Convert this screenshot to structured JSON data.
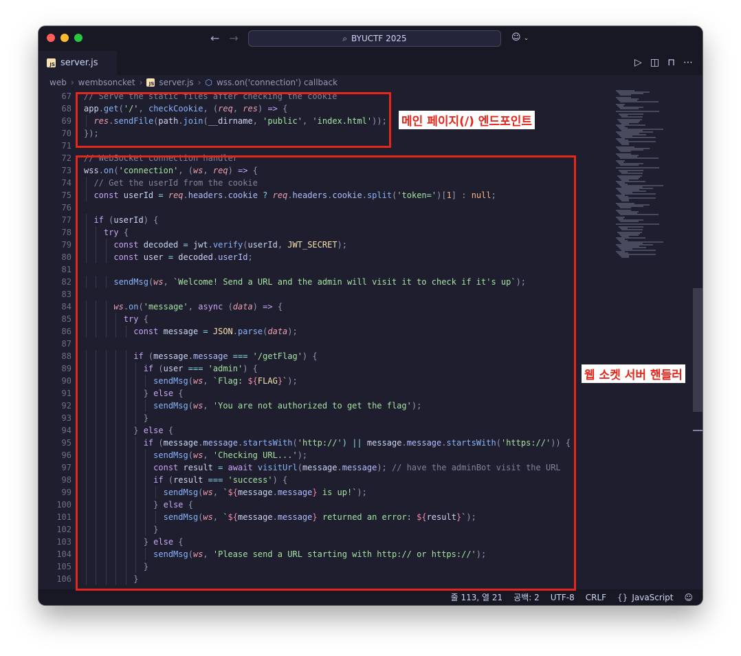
{
  "window": {
    "search_text": "BYUCTF 2025",
    "tab": {
      "label": "server.js",
      "badge": "JS"
    },
    "breadcrumbs": [
      "web",
      "wembsoncket",
      "server.js",
      "wss.on('connection') callback"
    ]
  },
  "editor": {
    "line_numbers": [
      "67",
      "68",
      "69",
      "70",
      "71",
      "72",
      "73",
      "74",
      "75",
      "76",
      "77",
      "78",
      "79",
      "80",
      "81",
      "82",
      "83",
      "84",
      "85",
      "86",
      "87",
      "88",
      "89",
      "90",
      "91",
      "92",
      "93",
      "94",
      "95",
      "96",
      "97",
      "98",
      "99",
      "100",
      "101",
      "102",
      "103",
      "104",
      "105",
      "106"
    ],
    "lines": [
      [
        {
          "t": "// Serve the static files after checking the cookie",
          "c": "c"
        }
      ],
      [
        {
          "t": "app",
          "c": "v"
        },
        {
          "t": ".",
          "c": "b"
        },
        {
          "t": "get",
          "c": "f"
        },
        {
          "t": "(",
          "c": "b"
        },
        {
          "t": "'/'",
          "c": "s"
        },
        {
          "t": ", ",
          "c": "b"
        },
        {
          "t": "checkCookie",
          "c": "f"
        },
        {
          "t": ", (",
          "c": "b"
        },
        {
          "t": "req",
          "c": "p"
        },
        {
          "t": ", ",
          "c": "b"
        },
        {
          "t": "res",
          "c": "p"
        },
        {
          "t": ") ",
          "c": "b"
        },
        {
          "t": "=>",
          "c": "k"
        },
        {
          "t": " {",
          "c": "b"
        }
      ],
      [
        {
          "t": "  ",
          "c": "v"
        },
        {
          "t": "res",
          "c": "p"
        },
        {
          "t": ".",
          "c": "b"
        },
        {
          "t": "sendFile",
          "c": "f"
        },
        {
          "t": "(",
          "c": "b"
        },
        {
          "t": "path",
          "c": "v"
        },
        {
          "t": ".",
          "c": "b"
        },
        {
          "t": "join",
          "c": "f"
        },
        {
          "t": "(",
          "c": "b"
        },
        {
          "t": "__dirname",
          "c": "v"
        },
        {
          "t": ", ",
          "c": "b"
        },
        {
          "t": "'public'",
          "c": "s"
        },
        {
          "t": ", ",
          "c": "b"
        },
        {
          "t": "'index.html'",
          "c": "s"
        },
        {
          "t": "));",
          "c": "b"
        }
      ],
      [
        {
          "t": "});",
          "c": "b"
        }
      ],
      [],
      [
        {
          "t": "// WebSocket connection handler",
          "c": "c"
        }
      ],
      [
        {
          "t": "wss",
          "c": "v"
        },
        {
          "t": ".",
          "c": "b"
        },
        {
          "t": "on",
          "c": "f"
        },
        {
          "t": "(",
          "c": "b"
        },
        {
          "t": "'connection'",
          "c": "s"
        },
        {
          "t": ", (",
          "c": "b"
        },
        {
          "t": "ws",
          "c": "p"
        },
        {
          "t": ", ",
          "c": "b"
        },
        {
          "t": "req",
          "c": "p"
        },
        {
          "t": ") ",
          "c": "b"
        },
        {
          "t": "=>",
          "c": "k"
        },
        {
          "t": " {",
          "c": "b"
        }
      ],
      [
        {
          "t": "  // Get the userId from the cookie",
          "c": "c"
        }
      ],
      [
        {
          "t": "  ",
          "c": "v"
        },
        {
          "t": "const",
          "c": "k"
        },
        {
          "t": " userId ",
          "c": "v"
        },
        {
          "t": "=",
          "c": "o"
        },
        {
          "t": " ",
          "c": "v"
        },
        {
          "t": "req",
          "c": "p"
        },
        {
          "t": ".",
          "c": "b"
        },
        {
          "t": "headers",
          "c": "pp"
        },
        {
          "t": ".",
          "c": "b"
        },
        {
          "t": "cookie",
          "c": "pp"
        },
        {
          "t": " ? ",
          "c": "o"
        },
        {
          "t": "req",
          "c": "p"
        },
        {
          "t": ".",
          "c": "b"
        },
        {
          "t": "headers",
          "c": "pp"
        },
        {
          "t": ".",
          "c": "b"
        },
        {
          "t": "cookie",
          "c": "pp"
        },
        {
          "t": ".",
          "c": "b"
        },
        {
          "t": "split",
          "c": "f"
        },
        {
          "t": "(",
          "c": "b"
        },
        {
          "t": "'token='",
          "c": "s"
        },
        {
          "t": ")[",
          "c": "b"
        },
        {
          "t": "1",
          "c": "n"
        },
        {
          "t": "] : ",
          "c": "b"
        },
        {
          "t": "null",
          "c": "n"
        },
        {
          "t": ";",
          "c": "b"
        }
      ],
      [],
      [
        {
          "t": "  ",
          "c": "v"
        },
        {
          "t": "if",
          "c": "k"
        },
        {
          "t": " (",
          "c": "b"
        },
        {
          "t": "userId",
          "c": "v"
        },
        {
          "t": ") {",
          "c": "b"
        }
      ],
      [
        {
          "t": "    ",
          "c": "v"
        },
        {
          "t": "try",
          "c": "k"
        },
        {
          "t": " {",
          "c": "b"
        }
      ],
      [
        {
          "t": "      ",
          "c": "v"
        },
        {
          "t": "const",
          "c": "k"
        },
        {
          "t": " decoded ",
          "c": "v"
        },
        {
          "t": "=",
          "c": "o"
        },
        {
          "t": " jwt",
          "c": "v"
        },
        {
          "t": ".",
          "c": "b"
        },
        {
          "t": "verify",
          "c": "f"
        },
        {
          "t": "(",
          "c": "b"
        },
        {
          "t": "userId",
          "c": "v"
        },
        {
          "t": ", ",
          "c": "b"
        },
        {
          "t": "JWT_SECRET",
          "c": "cn"
        },
        {
          "t": ");",
          "c": "b"
        }
      ],
      [
        {
          "t": "      ",
          "c": "v"
        },
        {
          "t": "const",
          "c": "k"
        },
        {
          "t": " user ",
          "c": "v"
        },
        {
          "t": "=",
          "c": "o"
        },
        {
          "t": " decoded",
          "c": "v"
        },
        {
          "t": ".",
          "c": "b"
        },
        {
          "t": "userId",
          "c": "pp"
        },
        {
          "t": ";",
          "c": "b"
        }
      ],
      [],
      [
        {
          "t": "      ",
          "c": "v"
        },
        {
          "t": "sendMsg",
          "c": "f"
        },
        {
          "t": "(",
          "c": "b"
        },
        {
          "t": "ws",
          "c": "p"
        },
        {
          "t": ", ",
          "c": "b"
        },
        {
          "t": "`Welcome! Send a URL and the admin will visit it to check if it's up`",
          "c": "s"
        },
        {
          "t": ");",
          "c": "b"
        }
      ],
      [],
      [
        {
          "t": "      ",
          "c": "v"
        },
        {
          "t": "ws",
          "c": "p"
        },
        {
          "t": ".",
          "c": "b"
        },
        {
          "t": "on",
          "c": "f"
        },
        {
          "t": "(",
          "c": "b"
        },
        {
          "t": "'message'",
          "c": "s"
        },
        {
          "t": ", ",
          "c": "b"
        },
        {
          "t": "async",
          "c": "k"
        },
        {
          "t": " (",
          "c": "b"
        },
        {
          "t": "data",
          "c": "p"
        },
        {
          "t": ") ",
          "c": "b"
        },
        {
          "t": "=>",
          "c": "k"
        },
        {
          "t": " {",
          "c": "b"
        }
      ],
      [
        {
          "t": "        ",
          "c": "v"
        },
        {
          "t": "try",
          "c": "k"
        },
        {
          "t": " {",
          "c": "b"
        }
      ],
      [
        {
          "t": "          ",
          "c": "v"
        },
        {
          "t": "const",
          "c": "k"
        },
        {
          "t": " message ",
          "c": "v"
        },
        {
          "t": "=",
          "c": "o"
        },
        {
          "t": " ",
          "c": "v"
        },
        {
          "t": "JSON",
          "c": "cn"
        },
        {
          "t": ".",
          "c": "b"
        },
        {
          "t": "parse",
          "c": "f"
        },
        {
          "t": "(",
          "c": "b"
        },
        {
          "t": "data",
          "c": "p"
        },
        {
          "t": ");",
          "c": "b"
        }
      ],
      [],
      [
        {
          "t": "          ",
          "c": "v"
        },
        {
          "t": "if",
          "c": "k"
        },
        {
          "t": " (",
          "c": "b"
        },
        {
          "t": "message",
          "c": "v"
        },
        {
          "t": ".",
          "c": "b"
        },
        {
          "t": "message",
          "c": "pp"
        },
        {
          "t": " === ",
          "c": "o"
        },
        {
          "t": "'/getFlag'",
          "c": "s"
        },
        {
          "t": ") {",
          "c": "b"
        }
      ],
      [
        {
          "t": "            ",
          "c": "v"
        },
        {
          "t": "if",
          "c": "k"
        },
        {
          "t": " (",
          "c": "b"
        },
        {
          "t": "user",
          "c": "v"
        },
        {
          "t": " === ",
          "c": "o"
        },
        {
          "t": "'admin'",
          "c": "s"
        },
        {
          "t": ") {",
          "c": "b"
        }
      ],
      [
        {
          "t": "              ",
          "c": "v"
        },
        {
          "t": "sendMsg",
          "c": "f"
        },
        {
          "t": "(",
          "c": "b"
        },
        {
          "t": "ws",
          "c": "p"
        },
        {
          "t": ", ",
          "c": "b"
        },
        {
          "t": "`Flag: ",
          "c": "s"
        },
        {
          "t": "${",
          "c": "iv"
        },
        {
          "t": "FLAG",
          "c": "cn"
        },
        {
          "t": "}",
          "c": "iv"
        },
        {
          "t": "`",
          "c": "s"
        },
        {
          "t": ");",
          "c": "b"
        }
      ],
      [
        {
          "t": "            ",
          "c": "v"
        },
        {
          "t": "}",
          "c": "b"
        },
        {
          "t": " else ",
          "c": "k"
        },
        {
          "t": "{",
          "c": "b"
        }
      ],
      [
        {
          "t": "              ",
          "c": "v"
        },
        {
          "t": "sendMsg",
          "c": "f"
        },
        {
          "t": "(",
          "c": "b"
        },
        {
          "t": "ws",
          "c": "p"
        },
        {
          "t": ", ",
          "c": "b"
        },
        {
          "t": "'You are not authorized to get the flag'",
          "c": "s"
        },
        {
          "t": ");",
          "c": "b"
        }
      ],
      [
        {
          "t": "            }",
          "c": "b"
        }
      ],
      [
        {
          "t": "          ",
          "c": "v"
        },
        {
          "t": "}",
          "c": "b"
        },
        {
          "t": " else ",
          "c": "k"
        },
        {
          "t": "{",
          "c": "b"
        }
      ],
      [
        {
          "t": "            ",
          "c": "v"
        },
        {
          "t": "if",
          "c": "k"
        },
        {
          "t": " (",
          "c": "b"
        },
        {
          "t": "message",
          "c": "v"
        },
        {
          "t": ".",
          "c": "b"
        },
        {
          "t": "message",
          "c": "pp"
        },
        {
          "t": ".",
          "c": "b"
        },
        {
          "t": "startsWith",
          "c": "f"
        },
        {
          "t": "(",
          "c": "b"
        },
        {
          "t": "'http://'",
          "c": "s"
        },
        {
          "t": ") || ",
          "c": "o"
        },
        {
          "t": "message",
          "c": "v"
        },
        {
          "t": ".",
          "c": "b"
        },
        {
          "t": "message",
          "c": "pp"
        },
        {
          "t": ".",
          "c": "b"
        },
        {
          "t": "startsWith",
          "c": "f"
        },
        {
          "t": "(",
          "c": "b"
        },
        {
          "t": "'https://'",
          "c": "s"
        },
        {
          "t": ")) {",
          "c": "b"
        }
      ],
      [
        {
          "t": "              ",
          "c": "v"
        },
        {
          "t": "sendMsg",
          "c": "f"
        },
        {
          "t": "(",
          "c": "b"
        },
        {
          "t": "ws",
          "c": "p"
        },
        {
          "t": ", ",
          "c": "b"
        },
        {
          "t": "'Checking URL...'",
          "c": "s"
        },
        {
          "t": ");",
          "c": "b"
        }
      ],
      [
        {
          "t": "              ",
          "c": "v"
        },
        {
          "t": "const",
          "c": "k"
        },
        {
          "t": " result ",
          "c": "v"
        },
        {
          "t": "=",
          "c": "o"
        },
        {
          "t": " ",
          "c": "v"
        },
        {
          "t": "await",
          "c": "k"
        },
        {
          "t": " ",
          "c": "v"
        },
        {
          "t": "visitUrl",
          "c": "f"
        },
        {
          "t": "(",
          "c": "b"
        },
        {
          "t": "message",
          "c": "v"
        },
        {
          "t": ".",
          "c": "b"
        },
        {
          "t": "message",
          "c": "pp"
        },
        {
          "t": "); ",
          "c": "b"
        },
        {
          "t": "// have the adminBot visit the URL",
          "c": "c"
        }
      ],
      [
        {
          "t": "              ",
          "c": "v"
        },
        {
          "t": "if",
          "c": "k"
        },
        {
          "t": " (",
          "c": "b"
        },
        {
          "t": "result",
          "c": "v"
        },
        {
          "t": " === ",
          "c": "o"
        },
        {
          "t": "'success'",
          "c": "s"
        },
        {
          "t": ") {",
          "c": "b"
        }
      ],
      [
        {
          "t": "                ",
          "c": "v"
        },
        {
          "t": "sendMsg",
          "c": "f"
        },
        {
          "t": "(",
          "c": "b"
        },
        {
          "t": "ws",
          "c": "p"
        },
        {
          "t": ", ",
          "c": "b"
        },
        {
          "t": "`",
          "c": "s"
        },
        {
          "t": "${",
          "c": "iv"
        },
        {
          "t": "message",
          "c": "v"
        },
        {
          "t": ".",
          "c": "b"
        },
        {
          "t": "message",
          "c": "pp"
        },
        {
          "t": "}",
          "c": "iv"
        },
        {
          "t": " is up!`",
          "c": "s"
        },
        {
          "t": ");",
          "c": "b"
        }
      ],
      [
        {
          "t": "              ",
          "c": "v"
        },
        {
          "t": "}",
          "c": "b"
        },
        {
          "t": " else ",
          "c": "k"
        },
        {
          "t": "{",
          "c": "b"
        }
      ],
      [
        {
          "t": "                ",
          "c": "v"
        },
        {
          "t": "sendMsg",
          "c": "f"
        },
        {
          "t": "(",
          "c": "b"
        },
        {
          "t": "ws",
          "c": "p"
        },
        {
          "t": ", ",
          "c": "b"
        },
        {
          "t": "`",
          "c": "s"
        },
        {
          "t": "${",
          "c": "iv"
        },
        {
          "t": "message",
          "c": "v"
        },
        {
          "t": ".",
          "c": "b"
        },
        {
          "t": "message",
          "c": "pp"
        },
        {
          "t": "}",
          "c": "iv"
        },
        {
          "t": " returned an error: ",
          "c": "s"
        },
        {
          "t": "${",
          "c": "iv"
        },
        {
          "t": "result",
          "c": "v"
        },
        {
          "t": "}",
          "c": "iv"
        },
        {
          "t": "`",
          "c": "s"
        },
        {
          "t": ");",
          "c": "b"
        }
      ],
      [
        {
          "t": "              }",
          "c": "b"
        }
      ],
      [
        {
          "t": "            ",
          "c": "v"
        },
        {
          "t": "}",
          "c": "b"
        },
        {
          "t": " else ",
          "c": "k"
        },
        {
          "t": "{",
          "c": "b"
        }
      ],
      [
        {
          "t": "              ",
          "c": "v"
        },
        {
          "t": "sendMsg",
          "c": "f"
        },
        {
          "t": "(",
          "c": "b"
        },
        {
          "t": "ws",
          "c": "p"
        },
        {
          "t": ", ",
          "c": "b"
        },
        {
          "t": "'Please send a URL starting with http:// or https://'",
          "c": "s"
        },
        {
          "t": ");",
          "c": "b"
        }
      ],
      [
        {
          "t": "            }",
          "c": "b"
        }
      ],
      [
        {
          "t": "          }",
          "c": "b"
        }
      ]
    ]
  },
  "status": {
    "cursor": "줄 113, 열 21",
    "spaces": "공백: 2",
    "encoding": "UTF-8",
    "eol": "CRLF",
    "language_brace": "{}",
    "language": "JavaScript"
  },
  "annotations": {
    "endpoint_label": "메인 페이지(/) 엔드포인트",
    "websocket_label": "웹 소켓 서버 핸들러"
  },
  "colors": {
    "highlight": "#e5261b",
    "editor_bg": "#1e1e2e",
    "chrome_bg": "#181825"
  }
}
